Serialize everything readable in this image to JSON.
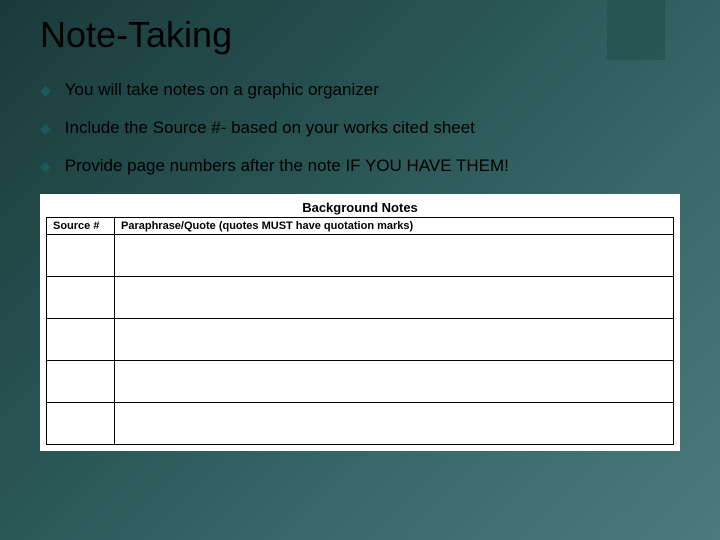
{
  "title": "Note-Taking",
  "bullets": [
    "You will take notes on a graphic organizer",
    "Include the Source #- based on your works cited sheet",
    "Provide page numbers after the note IF YOU HAVE THEM!"
  ],
  "table": {
    "title": "Background Notes",
    "headers": {
      "source": "Source #",
      "paraphrase": "Paraphrase/Quote (quotes MUST have quotation marks)"
    },
    "row_count": 5
  }
}
